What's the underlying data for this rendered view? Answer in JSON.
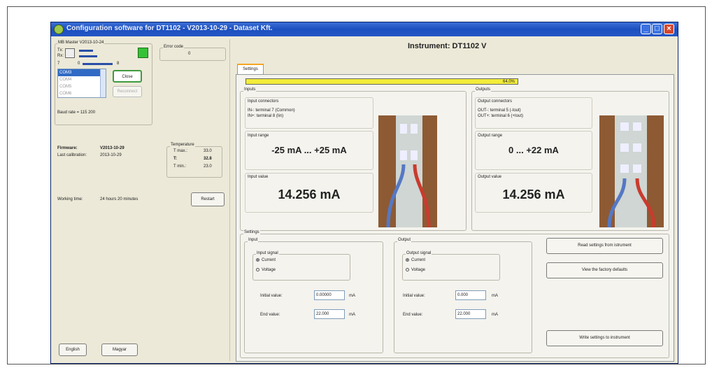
{
  "window": {
    "title": "Configuration software for DT1102 - V2013-10-29 - Dataset Kft."
  },
  "master": {
    "label": "MB Master V2013-10-24",
    "tx": "Tx:",
    "rx": "Rx:",
    "bar_min": "7",
    "bar_start": "0",
    "bar_end": "8",
    "com_ports": [
      "COM3",
      "COM4",
      "COM5",
      "COM6"
    ],
    "close_label": "Close",
    "reconnect_label": "Reconnect",
    "baud": "Baud rate = 115 200"
  },
  "error": {
    "label": "Error code",
    "value": "0"
  },
  "firmware": {
    "label": "Firmware:",
    "value": "V2013-10-29",
    "cal_label": "Last calibration:",
    "cal_value": "2013-10-29"
  },
  "temperature": {
    "label": "Temperature",
    "tmax_label": "T max.:",
    "tmax": "33.0",
    "t_label": "T:",
    "t": "32.8",
    "tmin_label": "T min.:",
    "tmin": "23.0"
  },
  "working": {
    "label": "Working time:",
    "value": "24 hours  20 minutes",
    "restart_label": "Restart"
  },
  "language": {
    "english": "English",
    "magyar": "Magyar"
  },
  "header": {
    "instrument": "Instrument: DT1102 V"
  },
  "tabs": [
    "Settings"
  ],
  "progress": {
    "value": 1.0,
    "text": "64.0%"
  },
  "inputs": {
    "title": "Inputs",
    "connectors_label": "Input connectors",
    "connector_lines": [
      "IN-: terminal 7 (Common)",
      "IN+: terminal 8 (Iin)"
    ],
    "range_label": "Input range",
    "range_value": "-25 mA ... +25 mA",
    "value_label": "Input value",
    "value": "14.256 mA"
  },
  "outputs": {
    "title": "Outputs",
    "connectors_label": "Output connectors",
    "connector_lines": [
      "OUT-: terminal 5 (-Iout)",
      "OUT+: terminal 6 (+Iout)"
    ],
    "range_label": "Output range",
    "range_value": "0 ... +22 mA",
    "value_label": "Output value",
    "value": "14.256 mA"
  },
  "settings": {
    "title": "Settings",
    "input": {
      "title": "Input",
      "signal_label": "Input signal",
      "current": "Current",
      "voltage": "Voltage",
      "initial_label": "Initial value:",
      "initial_value": "0.00000",
      "end_label": "End value:",
      "end_value": "22.000",
      "unit": "mA"
    },
    "output": {
      "title": "Output",
      "signal_label": "Output signal",
      "current": "Current",
      "voltage": "Voltage",
      "initial_label": "Initial value:",
      "initial_value": "0.000",
      "end_label": "End value:",
      "end_value": "22.000",
      "unit": "mA"
    },
    "read_button": "Read settings from istrument",
    "defaults_button": "View the factory defaults",
    "write_button": "Write settings to instrument"
  },
  "colors": {
    "title_bar": "#2456c6",
    "progress_fill": "#f2ec3a",
    "connected_indicator": "#36c236",
    "window_bg": "#ece9d8"
  }
}
